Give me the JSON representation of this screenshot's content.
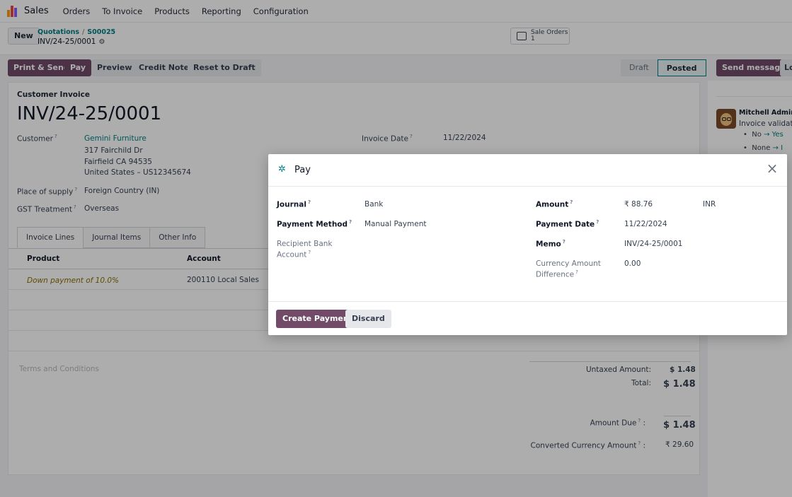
{
  "nav": {
    "app_name": "Sales",
    "menus": [
      "Orders",
      "To Invoice",
      "Products",
      "Reporting",
      "Configuration"
    ],
    "logo_colors": [
      "#f59e0b",
      "#ef4444",
      "#8b5cf6"
    ]
  },
  "control": {
    "new_label": "New",
    "breadcrumb": [
      "Quotations",
      "S00025"
    ],
    "breadcrumb_sep": "/",
    "record_name": "INV/24-25/0001",
    "smart_button": {
      "label": "Sale Orders",
      "count": "1"
    }
  },
  "actions": {
    "print_send": "Print & Send",
    "pay": "Pay",
    "preview": "Preview",
    "credit_note": "Credit Note",
    "reset_to_draft": "Reset to Draft"
  },
  "status": {
    "draft": "Draft",
    "posted": "Posted",
    "active": "Posted"
  },
  "invoice": {
    "type": "Customer Invoice",
    "name": "INV/24-25/0001",
    "customer_label": "Customer",
    "customer_name": "Gemini Furniture",
    "address_1": "317 Fairchild Dr",
    "address_2": "Fairfield CA 94535",
    "address_3": "United States – US12345674",
    "place_of_supply_label": "Place of supply",
    "place_of_supply": "Foreign Country (IN)",
    "gst_label": "GST Treatment",
    "gst": "Overseas",
    "invoice_date_label": "Invoice Date",
    "invoice_date": "11/22/2024"
  },
  "tabs": [
    "Invoice Lines",
    "Journal Items",
    "Other Info"
  ],
  "lines": {
    "headers": {
      "product": "Product",
      "account": "Account"
    },
    "rows": [
      {
        "product": "Down payment of 10.0%",
        "account": "200110 Local Sales"
      }
    ]
  },
  "terms_placeholder": "Terms and Conditions",
  "totals": {
    "untaxed_label": "Untaxed Amount:",
    "untaxed": "$ 1.48",
    "total_label": "Total:",
    "total": "$ 1.48",
    "due_label": "Amount Due",
    "due": "$ 1.48",
    "converted_label": "Converted Currency Amount",
    "converted": "₹ 29.60"
  },
  "chatter": {
    "send_message": "Send message",
    "log_note": "Lo",
    "author": "Mitchell Admin",
    "message": "Invoice validated",
    "changes": [
      {
        "from": "No",
        "to": "Yes"
      },
      {
        "from": "None",
        "to": "I"
      }
    ]
  },
  "modal": {
    "title": "Pay",
    "journal_label": "Journal",
    "journal": "Bank",
    "payment_method_label": "Payment Method",
    "payment_method": "Manual Payment",
    "recipient_label_1": "Recipient Bank",
    "recipient_label_2": "Account",
    "amount_label": "Amount",
    "amount": "₹ 88.76",
    "currency": "INR",
    "payment_date_label": "Payment Date",
    "payment_date": "11/22/2024",
    "memo_label": "Memo",
    "memo": "INV/24-25/0001",
    "currency_diff_label_1": "Currency Amount",
    "currency_diff_label_2": "Difference",
    "currency_diff": "0.00",
    "create_payment": "Create Payment",
    "discard": "Discard"
  }
}
